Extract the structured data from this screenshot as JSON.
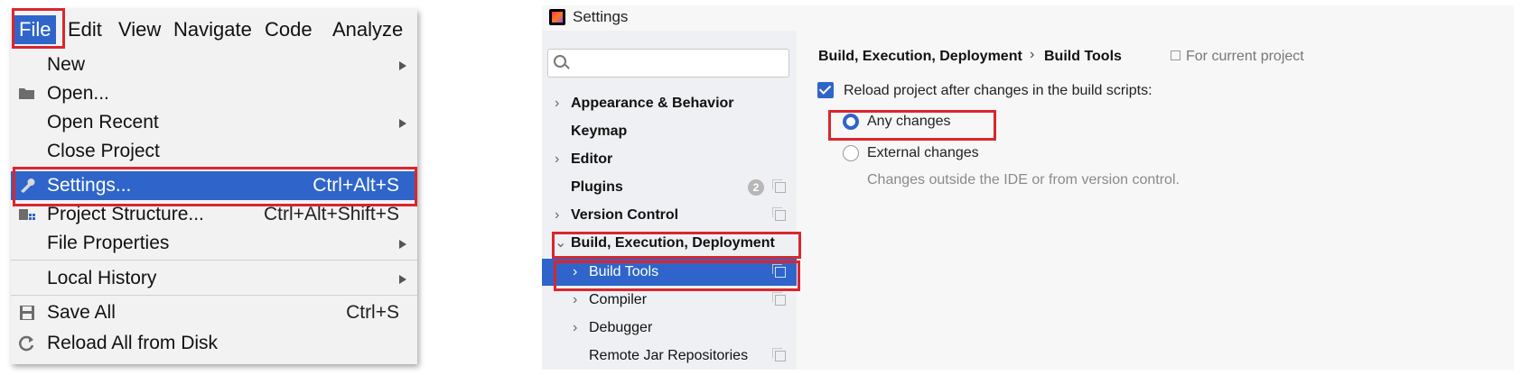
{
  "menu": {
    "menubar": [
      "File",
      "Edit",
      "View",
      "Navigate",
      "Code",
      "Analyze"
    ],
    "items": [
      {
        "label": "New",
        "submenu": true
      },
      {
        "label": "Open...",
        "icon": "folder-icon"
      },
      {
        "label": "Open Recent",
        "submenu": true
      },
      {
        "label": "Close Project"
      },
      {
        "label": "Settings...",
        "shortcut": "Ctrl+Alt+S",
        "icon": "wrench-icon",
        "selected": true
      },
      {
        "label": "Project Structure...",
        "shortcut": "Ctrl+Alt+Shift+S",
        "icon": "project-structure-icon"
      },
      {
        "label": "File Properties",
        "submenu": true
      },
      {
        "label": "Local History",
        "submenu": true
      },
      {
        "label": "Save All",
        "shortcut": "Ctrl+S",
        "icon": "save-icon"
      },
      {
        "label": "Reload All from Disk",
        "icon": "reload-icon"
      }
    ]
  },
  "settings": {
    "title": "Settings",
    "sidebar": [
      {
        "label": "Appearance & Behavior",
        "expandable": true
      },
      {
        "label": "Keymap"
      },
      {
        "label": "Editor",
        "expandable": true
      },
      {
        "label": "Plugins",
        "badge": "2"
      },
      {
        "label": "Version Control",
        "expandable": true
      },
      {
        "label": "Build, Execution, Deployment",
        "expanded": true
      },
      {
        "label": "Build Tools",
        "expandable": true,
        "selected": true
      },
      {
        "label": "Compiler",
        "expandable": true
      },
      {
        "label": "Debugger",
        "expandable": true
      },
      {
        "label": "Remote Jar Repositories"
      }
    ],
    "breadcrumb": [
      "Build, Execution, Deployment",
      "Build Tools"
    ],
    "breadcrumb_sep": "›",
    "for_current_project": "For current project",
    "reload_checkbox_label": "Reload project after changes in the build scripts:",
    "reload_checked": true,
    "radio_any": "Any changes",
    "radio_external": "External changes",
    "radio_selected": "Any changes",
    "external_hint": "Changes outside the IDE or from version control."
  },
  "colors": {
    "accent": "#2f65ca",
    "highlight_box": "#d9262e"
  }
}
